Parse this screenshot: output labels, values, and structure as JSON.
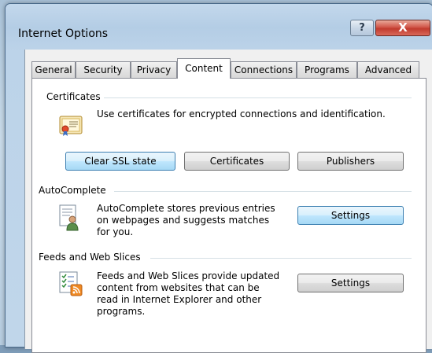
{
  "window": {
    "title": "Internet Options",
    "help_label": "?",
    "close_label": "X"
  },
  "tabs": [
    {
      "label": "General"
    },
    {
      "label": "Security"
    },
    {
      "label": "Privacy"
    },
    {
      "label": "Content",
      "active": true
    },
    {
      "label": "Connections"
    },
    {
      "label": "Programs"
    },
    {
      "label": "Advanced"
    }
  ],
  "certificates": {
    "heading": "Certificates",
    "description": "Use certificates for encrypted connections and identification.",
    "icon": "certificate-icon",
    "buttons": {
      "clear_ssl": "Clear SSL state",
      "certificates": "Certificates",
      "publishers": "Publishers"
    }
  },
  "autocomplete": {
    "heading": "AutoComplete",
    "description_lines": [
      "AutoComplete stores previous entries",
      "on webpages and suggests matches",
      "for you."
    ],
    "icon": "autocomplete-icon",
    "settings_label": "Settings"
  },
  "feeds": {
    "heading": "Feeds and Web Slices",
    "description_lines": [
      "Feeds and Web Slices provide updated",
      "content from websites that can be",
      "read in Internet Explorer and other",
      "programs."
    ],
    "icon": "feeds-icon",
    "settings_label": "Settings"
  },
  "colors": {
    "accent": "#3c7fb1",
    "close": "#c13b2e"
  }
}
